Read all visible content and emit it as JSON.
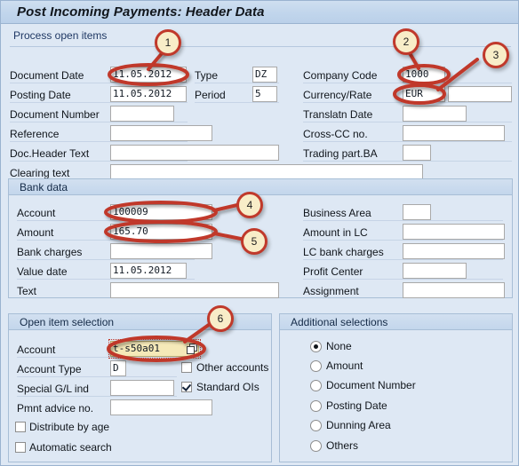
{
  "window": {
    "title": "Post Incoming Payments: Header Data",
    "subheader": "Process open items"
  },
  "header_form": {
    "left": [
      {
        "label": "Document Date",
        "value": "11.05.2012"
      },
      {
        "label": "Posting Date",
        "value": "11.05.2012"
      },
      {
        "label": "Document Number",
        "value": ""
      },
      {
        "label": "Reference",
        "value": ""
      },
      {
        "label": "Doc.Header Text",
        "value": ""
      },
      {
        "label": "Clearing text",
        "value": ""
      }
    ],
    "middle": [
      {
        "label": "Type",
        "value": "DZ"
      },
      {
        "label": "Period",
        "value": "5"
      }
    ],
    "right": [
      {
        "label": "Company Code",
        "value": "1000"
      },
      {
        "label": "Currency/Rate",
        "value": "EUR",
        "value2": ""
      },
      {
        "label": "Translatn Date",
        "value": ""
      },
      {
        "label": "Cross-CC no.",
        "value": ""
      },
      {
        "label": "Trading part.BA",
        "value": ""
      }
    ]
  },
  "bank_data": {
    "title": "Bank data",
    "left": [
      {
        "label": "Account",
        "value": "100009"
      },
      {
        "label": "Amount",
        "value": "165.70"
      },
      {
        "label": "Bank charges",
        "value": ""
      },
      {
        "label": "Value date",
        "value": "11.05.2012"
      },
      {
        "label": "Text",
        "value": ""
      }
    ],
    "right": [
      {
        "label": "Business Area",
        "value": ""
      },
      {
        "label": "Amount in LC",
        "value": ""
      },
      {
        "label": "LC bank charges",
        "value": ""
      },
      {
        "label": "Profit Center",
        "value": ""
      },
      {
        "label": "Assignment",
        "value": ""
      }
    ]
  },
  "open_item_selection": {
    "title": "Open item selection",
    "fields": [
      {
        "label": "Account",
        "value": "t-s50a01"
      },
      {
        "label": "Account Type",
        "value": "D"
      },
      {
        "label": "Special G/L ind",
        "value": ""
      },
      {
        "label": "Pmnt advice no.",
        "value": ""
      }
    ],
    "checkboxes": [
      {
        "label": "Other accounts",
        "checked": false
      },
      {
        "label": "Standard OIs",
        "checked": true
      },
      {
        "label": "Distribute by age",
        "checked": false
      },
      {
        "label": "Automatic search",
        "checked": false
      }
    ],
    "value_help_icon": "value-help-icon"
  },
  "additional_selections": {
    "title": "Additional selections",
    "options": [
      {
        "label": "None",
        "selected": true
      },
      {
        "label": "Amount",
        "selected": false
      },
      {
        "label": "Document Number",
        "selected": false
      },
      {
        "label": "Posting Date",
        "selected": false
      },
      {
        "label": "Dunning Area",
        "selected": false
      },
      {
        "label": "Others",
        "selected": false
      }
    ]
  },
  "annotations": {
    "accent_color": "#c0392b",
    "badge_fill": "#f8edc8",
    "callouts": [
      {
        "number": "1",
        "target": "document-date-field"
      },
      {
        "number": "2",
        "target": "company-code-field"
      },
      {
        "number": "3",
        "target": "currency-rate-field"
      },
      {
        "number": "4",
        "target": "bank-account-field"
      },
      {
        "number": "5",
        "target": "bank-amount-field"
      },
      {
        "number": "6",
        "target": "open-item-account-field"
      }
    ]
  }
}
